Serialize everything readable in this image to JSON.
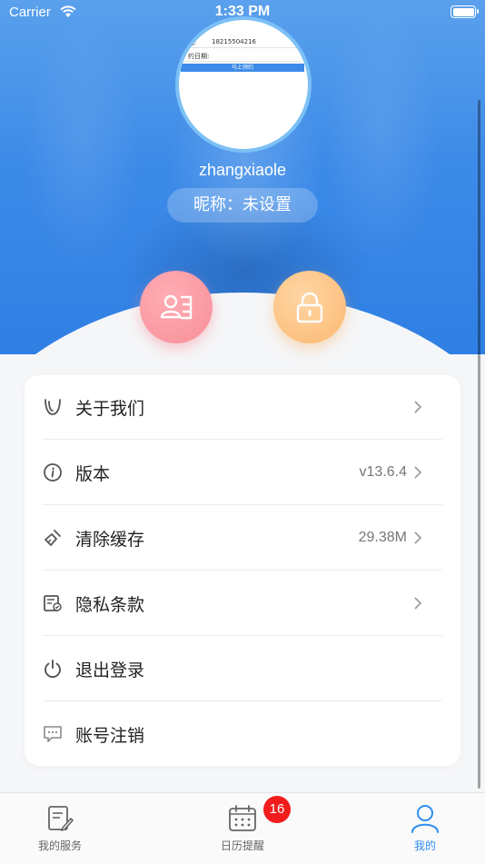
{
  "status_bar": {
    "carrier": "Carrier",
    "time": "1:33 PM"
  },
  "profile": {
    "avatar_preview": {
      "phone_label": "话:",
      "phone_value": "18215504216",
      "date_label": "约日期:",
      "submit_label": "马上预约"
    },
    "username": "zhangxiaole",
    "nickname": "昵称：未设置"
  },
  "actions": [
    {
      "icon": "profile-card-icon",
      "color": "#f88f99"
    },
    {
      "icon": "lock-icon",
      "color": "#fbb871"
    }
  ],
  "menu": [
    {
      "icon": "about-icon",
      "label": "关于我们",
      "value": ""
    },
    {
      "icon": "info-icon",
      "label": "版本",
      "value": "v13.6.4"
    },
    {
      "icon": "broom-icon",
      "label": "清除缓存",
      "value": "29.38M"
    },
    {
      "icon": "privacy-document-icon",
      "label": "隐私条款",
      "value": ""
    },
    {
      "icon": "power-icon",
      "label": "退出登录",
      "value": ""
    },
    {
      "icon": "chat-icon",
      "label": "账号注销",
      "value": ""
    }
  ],
  "tabbar": {
    "tabs": [
      {
        "icon": "service-icon",
        "label": "我的服务"
      },
      {
        "icon": "calendar-icon",
        "label": "日历提醒",
        "badge": "16"
      },
      {
        "icon": "user-icon",
        "label": "我的",
        "active": true
      }
    ]
  },
  "colors": {
    "header_blue": "#3d8be8",
    "accent": "#2f8ef2",
    "badge_red": "#f11d1d"
  }
}
